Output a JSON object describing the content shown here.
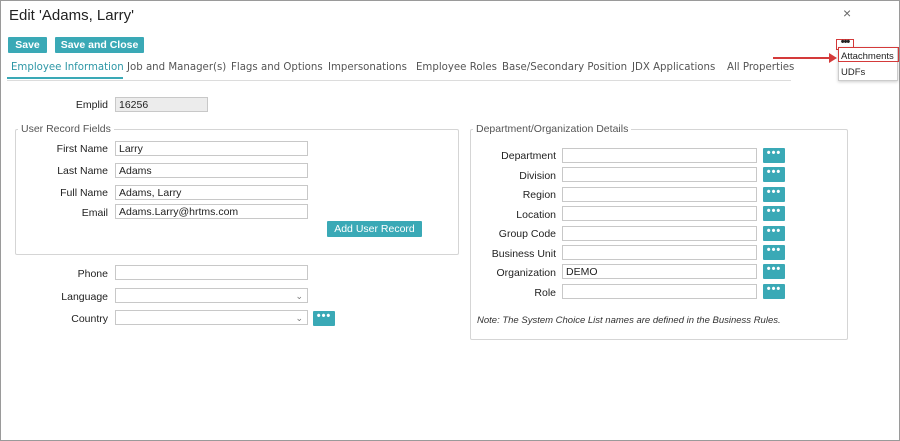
{
  "dialog": {
    "title": "Edit 'Adams, Larry'",
    "close": "×"
  },
  "toolbar": {
    "save_label": "Save",
    "save_close_label": "Save and Close",
    "more_label": "•••"
  },
  "tabs": [
    "Employee Information",
    "Job and Manager(s)",
    "Flags and Options",
    "Impersonations",
    "Employee Roles",
    "Base/Secondary Position",
    "JDX Applications",
    "All Properties"
  ],
  "menu": {
    "items": [
      "Attachments",
      "UDFs"
    ]
  },
  "emplid": {
    "label": "Emplid",
    "value": "16256"
  },
  "user_record": {
    "legend": "User Record Fields",
    "first_name_label": "First Name",
    "first_name": "Larry",
    "last_name_label": "Last Name",
    "last_name": "Adams",
    "full_name_label": "Full Name",
    "full_name": "Adams, Larry",
    "email_label": "Email",
    "email": "Adams.Larry@hrtms.com",
    "add_button": "Add User Record"
  },
  "contact": {
    "phone_label": "Phone",
    "phone": "",
    "language_label": "Language",
    "language": "",
    "country_label": "Country",
    "country": ""
  },
  "dept": {
    "legend": "Department/Organization Details",
    "department_label": "Department",
    "department": "",
    "division_label": "Division",
    "division": "",
    "region_label": "Region",
    "region": "",
    "location_label": "Location",
    "location": "",
    "group_code_label": "Group Code",
    "group_code": "",
    "business_unit_label": "Business Unit",
    "business_unit": "",
    "organization_label": "Organization",
    "organization": "DEMO",
    "role_label": "Role",
    "role": "",
    "note": "Note: The System Choice List names are defined in the Business Rules."
  },
  "colors": {
    "accent": "#3aa9b6",
    "highlight": "#d43a3a"
  }
}
